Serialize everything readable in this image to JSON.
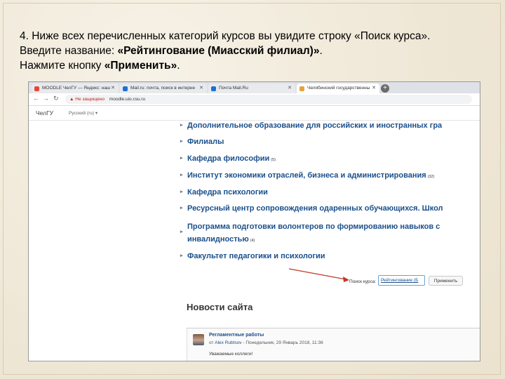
{
  "instructions": {
    "line1": "4. Ниже всех перечисленных категорий курсов вы увидите строку «Поиск курса».",
    "line2_prefix": "Введите название: ",
    "line2_bold": "«Рейтингование (Миасский филиал)»",
    "line2_suffix": ".",
    "line3_prefix": "Нажмите кнопку ",
    "line3_bold": "«Применить»",
    "line3_suffix": "."
  },
  "browser": {
    "tabs": [
      {
        "label": "MOODLE ЧелГУ — Яндекс: наш",
        "active": false,
        "favicon_color": "#e8453c"
      },
      {
        "label": "Mail.ru: почта, поиск в интерне",
        "active": false,
        "favicon_color": "#1f6fd1"
      },
      {
        "label": "Почта Mail.Ru",
        "active": false,
        "favicon_color": "#1f6fd1"
      },
      {
        "label": "Челябинский государственны",
        "active": true,
        "favicon_color": "#e6a23c"
      }
    ],
    "new_tab_icon": "+",
    "address": {
      "security_label": "Не защищено",
      "url": "moodle.uio.csu.ru"
    }
  },
  "site": {
    "logo": "ЧелГУ",
    "language": "Русский (ru) ▾",
    "categories": [
      {
        "label": "Дополнительное образование для российских и иностранных гра",
        "count": ""
      },
      {
        "label": "Филиалы",
        "count": ""
      },
      {
        "label": "Кафедра философии",
        "count": "(5)"
      },
      {
        "label": "Институт экономики отраслей, бизнеса и администрирования",
        "count": "(32)"
      },
      {
        "label": "Кафедра психологии",
        "count": ""
      },
      {
        "label": "Ресурсный центр сопровождения одаренных обучающихся. Школ",
        "count": ""
      },
      {
        "label": "Программа подготовки волонтеров по формированию навыков с",
        "count": ""
      },
      {
        "label": "инвалидностью",
        "count": "(4)"
      },
      {
        "label": "Факультет педагогики и психологии",
        "count": ""
      }
    ],
    "search": {
      "label": "Поиск курса:",
      "value": "Рейтингование (Б",
      "button": "Применить"
    },
    "news": {
      "title": "Новости сайта",
      "post_title": "Регламентные работы",
      "post_meta_prefix": "от ",
      "post_author": "Alex Rubtsov",
      "post_date": " - Понедельник, 29 Январь 2018, 11:36",
      "post_body": "Уважаемые коллеги!"
    }
  },
  "colors": {
    "link": "#1a4f8b",
    "annotation_arrow": "#c0392b"
  }
}
